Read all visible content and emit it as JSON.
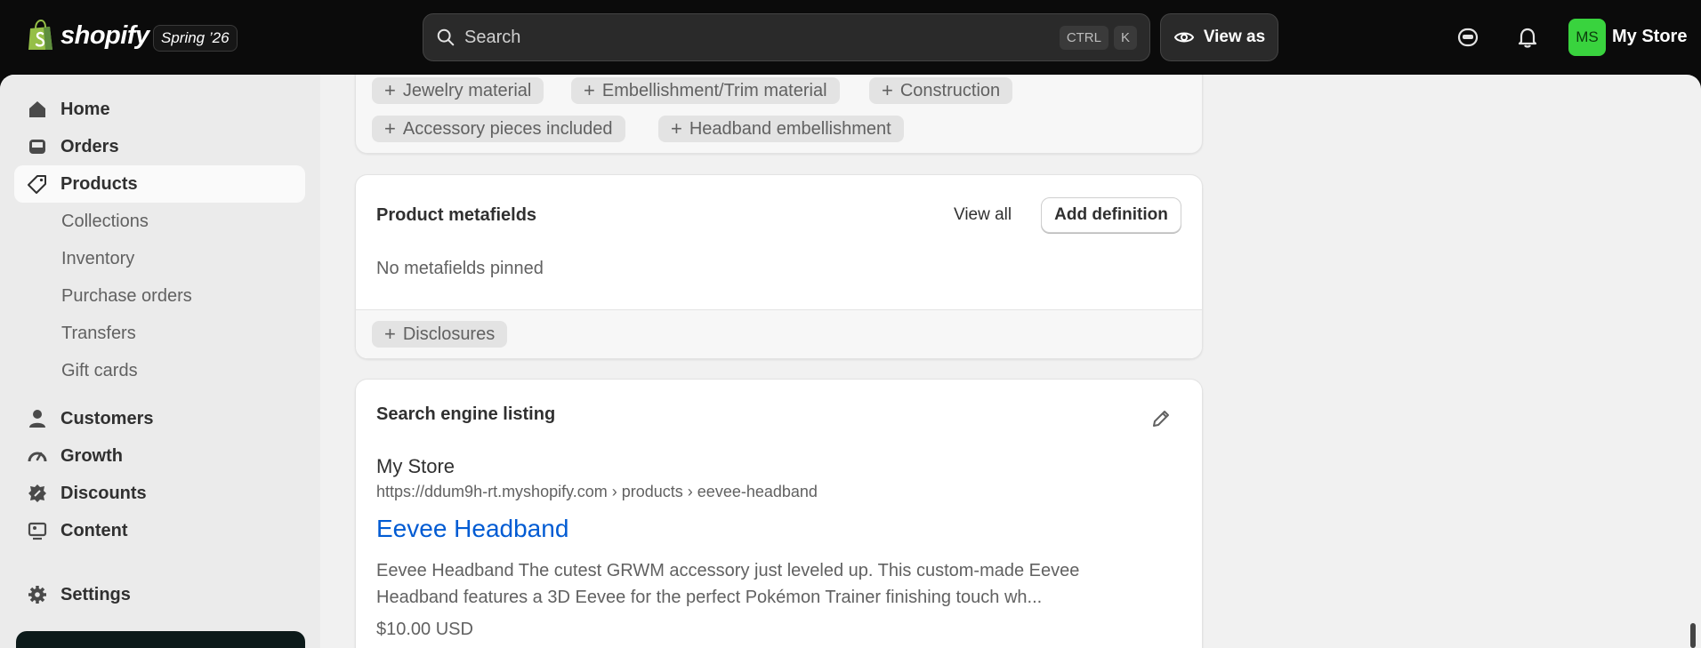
{
  "topbar": {
    "logo_text": "shopify",
    "release_badge": "Spring ’26",
    "search": {
      "placeholder": "Search",
      "shortcut_keys": [
        "CTRL",
        "K"
      ]
    },
    "view_as_label": "View as",
    "avatar_initials": "MS",
    "store_name": "My Store",
    "accent_green": "#39d33e"
  },
  "sidebar": {
    "items": [
      {
        "label": "Home",
        "icon": "home-icon"
      },
      {
        "label": "Orders",
        "icon": "inbox-icon"
      },
      {
        "label": "Products",
        "icon": "tag-icon",
        "active": true
      },
      {
        "label": "Customers",
        "icon": "person-icon"
      },
      {
        "label": "Growth",
        "icon": "gauge-icon"
      },
      {
        "label": "Discounts",
        "icon": "discount-icon"
      },
      {
        "label": "Content",
        "icon": "image-icon"
      },
      {
        "label": "Settings",
        "icon": "gear-icon"
      }
    ],
    "product_subitems": [
      "Collections",
      "Inventory",
      "Purchase orders",
      "Transfers",
      "Gift cards"
    ]
  },
  "attributes_card": {
    "chips": [
      "Jewelry material",
      "Embellishment/Trim material",
      "Construction",
      "Accessory pieces included",
      "Headband embellishment"
    ]
  },
  "metafields_card": {
    "title": "Product metafields",
    "view_all": "View all",
    "add_definition": "Add definition",
    "empty_text": "No metafields pinned",
    "chips": [
      "Disclosures"
    ]
  },
  "seo_card": {
    "title": "Search engine listing",
    "store_name": "My Store",
    "url": "https://ddum9h-rt.myshopify.com › products › eevee-headband",
    "page_title": "Eevee Headband",
    "description_line1": "Eevee Headband The cutest GRWM accessory just leveled up. This custom-made Eevee",
    "description_line2": "Headband features a 3D Eevee for the perfect Pokémon Trainer finishing touch wh...",
    "price": "$10.00 USD",
    "link_color": "#005bd3"
  }
}
